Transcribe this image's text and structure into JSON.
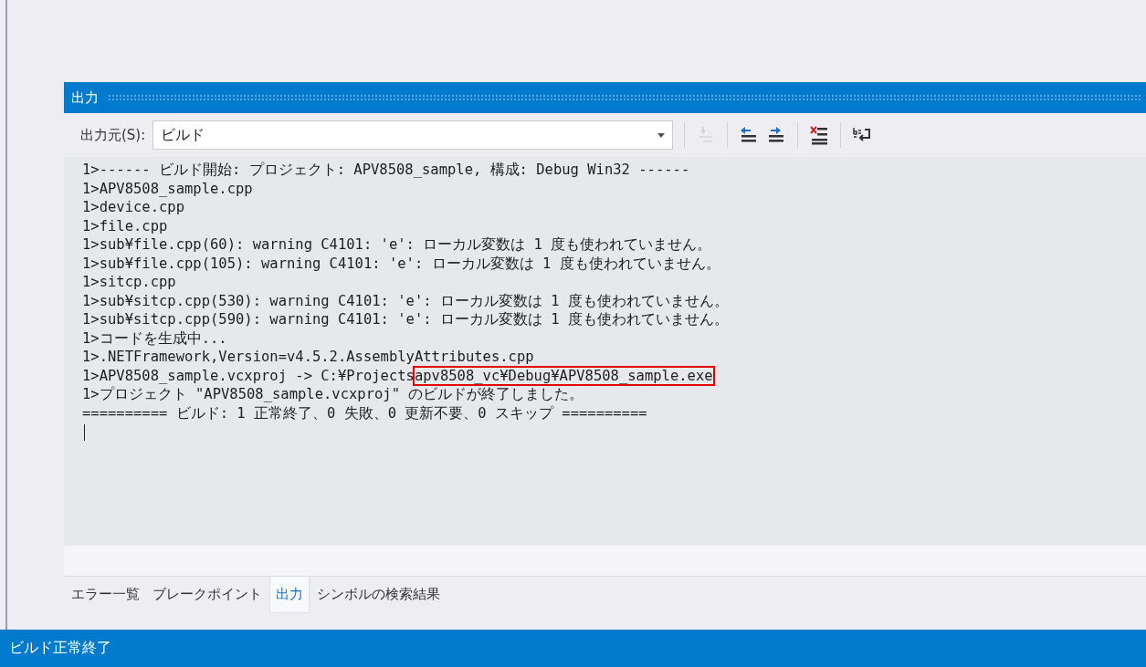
{
  "panel": {
    "title": "出力"
  },
  "toolbar": {
    "source_label": "出力元(S):",
    "source_value": "ビルド",
    "tools": [
      {
        "kind": "goto-code",
        "disabled": true
      },
      {
        "kind": "prev",
        "disabled": false
      },
      {
        "kind": "next",
        "disabled": false
      },
      {
        "kind": "clear",
        "disabled": false
      },
      {
        "kind": "wrap",
        "disabled": false
      }
    ]
  },
  "output_lines": [
    {
      "text": "1>------ ビルド開始: プロジェクト: APV8508_sample, 構成: Debug Win32 ------"
    },
    {
      "text": "1>APV8508_sample.cpp"
    },
    {
      "text": "1>device.cpp"
    },
    {
      "text": "1>file.cpp"
    },
    {
      "text": "1>sub¥file.cpp(60): warning C4101: 'e': ローカル変数は 1 度も使われていません。"
    },
    {
      "text": "1>sub¥file.cpp(105): warning C4101: 'e': ローカル変数は 1 度も使われていません。"
    },
    {
      "text": "1>sitcp.cpp"
    },
    {
      "text": "1>sub¥sitcp.cpp(530): warning C4101: 'e': ローカル変数は 1 度も使われていません。"
    },
    {
      "text": "1>sub¥sitcp.cpp(590): warning C4101: 'e': ローカル変数は 1 度も使われていません。"
    },
    {
      "text": "1>コードを生成中..."
    },
    {
      "text": "1>.NETFramework,Version=v4.5.2.AssemblyAttributes.cpp"
    },
    {
      "text": "1>APV8508_sample.vcxproj -> C:¥Projects",
      "boxed_text": "apv8508_vc¥Debug¥APV8508_sample.exe"
    },
    {
      "text": "1>プロジェクト \"APV8508_sample.vcxproj\" のビルドが終了しました。"
    },
    {
      "text": "========== ビルド: 1 正常終了、0 失敗、0 更新不要、0 スキップ =========="
    }
  ],
  "tabs": [
    {
      "label": "エラー一覧",
      "selected": false
    },
    {
      "label": "ブレークポイント",
      "selected": false
    },
    {
      "label": "出力",
      "selected": true
    },
    {
      "label": "シンボルの検索結果",
      "selected": false
    }
  ],
  "status_bar": {
    "text": "ビルド正常終了"
  }
}
